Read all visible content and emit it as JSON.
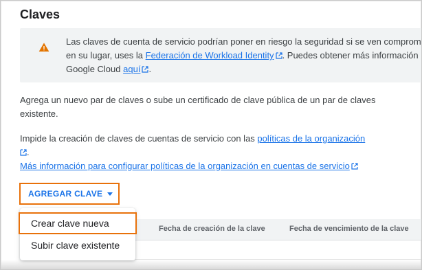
{
  "page": {
    "title": "Claves"
  },
  "warning": {
    "line1": "Las claves de cuenta de servicio podrían poner en riesgo la seguridad si se ven comprom",
    "line2_prefix": "en su lugar, uses la ",
    "line2_link": "Federación de Workload Identity",
    "line2_suffix": ". Puedes obtener más información",
    "line3_prefix": "Google Cloud ",
    "line3_link": "aquí",
    "line3_suffix": "."
  },
  "intro": {
    "text": "Agrega un nuevo par de claves o sube un certificado de clave pública de un par de claves existente."
  },
  "policy": {
    "prefix": "Impide la creación de claves de cuentas de servicio con las ",
    "link": "políticas de la organización",
    "suffix": ".",
    "more_link": "Más información para configurar políticas de la organización en cuentas de servicio"
  },
  "add_key": {
    "label": "AGREGAR CLAVE"
  },
  "menu": {
    "items": [
      "Crear clave nueva",
      "Subir clave existente"
    ]
  },
  "table": {
    "columns": [
      "Fecha de creación de la clave",
      "Fecha de vencimiento de la clave"
    ]
  },
  "colors": {
    "accent": "#1a73e8",
    "highlight": "#e8710a",
    "warning": "#e37400"
  },
  "icons": {
    "warning": "warning-icon",
    "external": "external-link-icon",
    "dropdown": "caret-down-icon"
  }
}
